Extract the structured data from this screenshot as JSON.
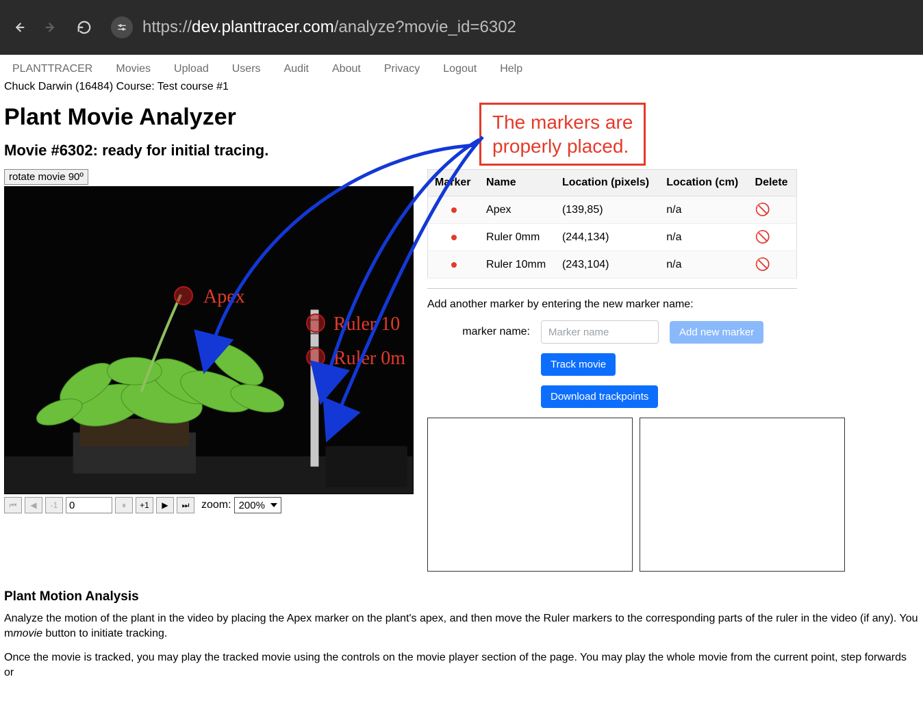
{
  "browser": {
    "url_prefix": "https://",
    "url_domain": "dev.planttracer.com",
    "url_path": "/analyze?movie_id=6302"
  },
  "nav": {
    "items": [
      "PLANTTRACER",
      "Movies",
      "Upload",
      "Users",
      "Audit",
      "About",
      "Privacy",
      "Logout",
      "Help"
    ]
  },
  "breadcrumb": "Chuck Darwin (16484) Course: Test course #1",
  "title": "Plant Movie Analyzer",
  "subtitle": "Movie #6302: ready for initial tracing.",
  "rotate_button": "rotate movie 90º",
  "annotation": {
    "line1": "The markers are",
    "line2": "properly placed."
  },
  "video_markers": {
    "apex_label": "Apex",
    "ruler10_label": "Ruler 10",
    "ruler0_label": "Ruler 0m"
  },
  "player": {
    "frame_value": "0",
    "minus1": "-1",
    "plus1": "+1",
    "zoom_label": "zoom:",
    "zoom_value": "200%"
  },
  "marker_table": {
    "headers": [
      "Marker",
      "Name",
      "Location (pixels)",
      "Location (cm)",
      "Delete"
    ],
    "rows": [
      {
        "name": "Apex",
        "loc_px": "(139,85)",
        "loc_cm": "n/a"
      },
      {
        "name": "Ruler 0mm",
        "loc_px": "(244,134)",
        "loc_cm": "n/a"
      },
      {
        "name": "Ruler 10mm",
        "loc_px": "(243,104)",
        "loc_cm": "n/a"
      }
    ]
  },
  "add_marker": {
    "prompt": "Add another marker by entering the new marker name:",
    "label": "marker name:",
    "placeholder": "Marker name",
    "add_button": "Add new marker",
    "track_button": "Track movie",
    "download_button": "Download trackpoints"
  },
  "analysis": {
    "heading": "Plant Motion Analysis",
    "para1_a": "Analyze the motion of the plant in the video by placing the Apex marker on the plant's apex, and then move the Ruler markers to the corresponding parts of the ruler in the video (if any). You m",
    "para1_em": "movie",
    "para1_b": " button to initiate tracking.",
    "para2": "Once the movie is tracked, you may play the tracked movie using the controls on the movie player section of the page. You may play the whole movie from the current point, step forwards or"
  }
}
